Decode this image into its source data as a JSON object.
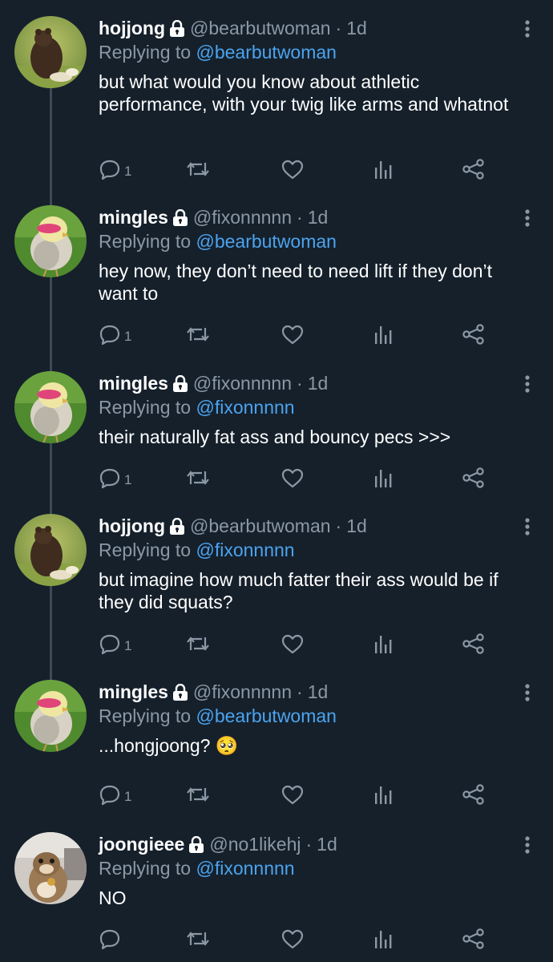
{
  "app": {
    "background": "#15202b",
    "accent": "#4ca3ee",
    "muted": "#8b98a5"
  },
  "tweets": [
    {
      "name": "hojjong",
      "handle": "@bearbutwoman",
      "dot": "·",
      "time": "1d",
      "replying_prefix": "Replying to",
      "replying_to": "@bearbutwoman",
      "text": "but what would you know about athletic performance, with your twig like arms and whatnot",
      "reply_count": "1",
      "avatar": "bear-avatar"
    },
    {
      "name": "mingles",
      "handle": "@fixonnnnn",
      "dot": "·",
      "time": "1d",
      "replying_prefix": "Replying to",
      "replying_to": "@bearbutwoman",
      "text": "hey now, they don’t need to need lift if they don’t want to",
      "reply_count": "1",
      "avatar": "chick-avatar"
    },
    {
      "name": "mingles",
      "handle": "@fixonnnnn",
      "dot": "·",
      "time": "1d",
      "replying_prefix": "Replying to",
      "replying_to": "@fixonnnnn",
      "text": "their naturally fat ass and  bouncy pecs >>>",
      "reply_count": "1",
      "avatar": "chick-avatar"
    },
    {
      "name": "hojjong",
      "handle": "@bearbutwoman",
      "dot": "·",
      "time": "1d",
      "replying_prefix": "Replying to",
      "replying_to": "@fixonnnnn",
      "text": "but imagine how much fatter their ass would be if they did squats?",
      "reply_count": "1",
      "avatar": "bear-avatar"
    },
    {
      "name": "mingles",
      "handle": "@fixonnnnn",
      "dot": "·",
      "time": "1d",
      "replying_prefix": "Replying to",
      "replying_to": "@bearbutwoman",
      "text": "...hongjoong? 🥺",
      "reply_count": "1",
      "avatar": "chick-avatar"
    },
    {
      "name": "joongieee",
      "handle": "@no1likehj",
      "dot": "·",
      "time": "1d",
      "replying_prefix": "Replying to",
      "replying_to": "@fixonnnnn",
      "text": "NO",
      "reply_count": "",
      "avatar": "chipmunk-avatar"
    }
  ]
}
